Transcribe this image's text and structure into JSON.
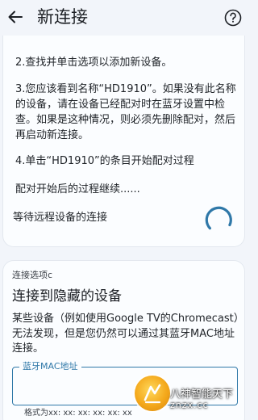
{
  "appbar": {
    "title": "新连接",
    "back_icon": "arrow-left-icon",
    "help_icon": "help-circle-icon"
  },
  "instructions": {
    "step2": "2.查找并单击选项以添加新设备。",
    "step3": "3.您应该看到名称“HD1910”。如果没有此名称的设备，请在设备已经配对时在蓝牙设置中检查。如果是这种情况，则必须先删除配对，然后再启动新连接。",
    "step4": "4.单击“HD1910”的条目开始配对过程",
    "step5": "配对开始后的过程继续......",
    "waiting": "等待远程设备的连接"
  },
  "hidden_device": {
    "option_label": "连接选项c",
    "heading": "连接到隐藏的设备",
    "description": "某些设备（例如使用Google TV的Chromecast）无法发现，但是您仍然可以通过其蓝牙MAC地址连接。",
    "field_label": "蓝牙MAC地址",
    "field_value": "",
    "format_hint": "格式为xx: xx: xx: xx: xx: xx"
  },
  "watermark": {
    "line1": "八神智能天下",
    "line2": "znzx.cc"
  },
  "colors": {
    "accent": "#2f78a8",
    "background": "#f2f5fa",
    "card": "#fbfdff"
  }
}
